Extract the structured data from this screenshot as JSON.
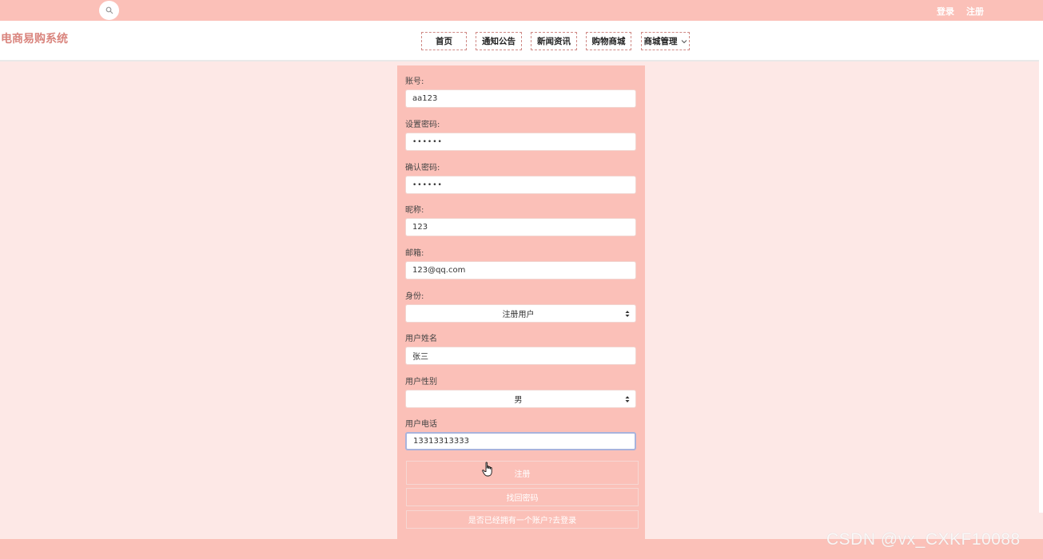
{
  "topbar": {
    "search_icon": "search-icon",
    "login_label": "登录",
    "register_label": "注册"
  },
  "navbar": {
    "brand": "电商易购系统",
    "items": [
      {
        "label": "首页"
      },
      {
        "label": "通知公告"
      },
      {
        "label": "新闻资讯"
      },
      {
        "label": "购物商城"
      },
      {
        "label": "商城管理",
        "icon": "chevron-down-icon"
      }
    ]
  },
  "form": {
    "account": {
      "label": "账号:",
      "value": "aa123"
    },
    "password": {
      "label": "设置密码:",
      "value": "••••••"
    },
    "confirm_password": {
      "label": "确认密码:",
      "value": "••••••"
    },
    "nickname": {
      "label": "昵称:",
      "value": "123"
    },
    "email": {
      "label": "邮箱:",
      "value": "123@qq.com"
    },
    "role": {
      "label": "身份:",
      "value": "注册用户"
    },
    "name": {
      "label": "用户姓名",
      "value": "张三"
    },
    "gender": {
      "label": "用户性别",
      "value": "男"
    },
    "phone": {
      "label": "用户电话",
      "value": "13313313333"
    },
    "register_button": "注册",
    "find_password_button": "找回密码",
    "has_account_link": "是否已经拥有一个账户?去登录"
  },
  "watermark": "CSDN @vx_CXKF10088",
  "colors": {
    "accent": "#fbc0b8",
    "page_bg": "#fde8e6",
    "brand": "#d9847d"
  }
}
